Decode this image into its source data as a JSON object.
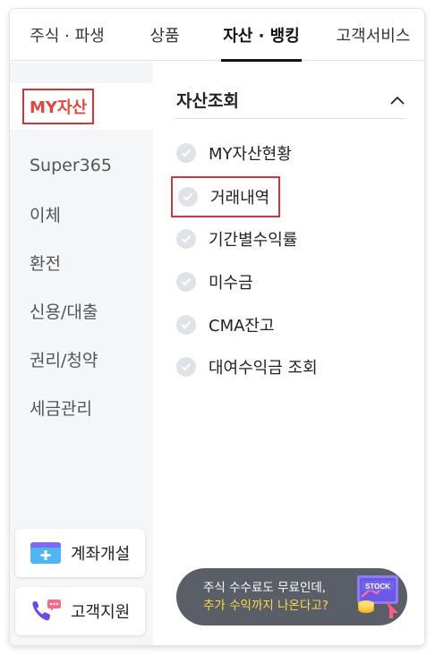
{
  "tabs": [
    {
      "label": "주식 · 파생"
    },
    {
      "label": "상품"
    },
    {
      "label": "자산 · 뱅킹"
    },
    {
      "label": "고객서비스"
    }
  ],
  "sidebar": {
    "items": [
      {
        "label": "MY자산"
      },
      {
        "label": "Super365"
      },
      {
        "label": "이체"
      },
      {
        "label": "환전"
      },
      {
        "label": "신용/대출"
      },
      {
        "label": "권리/청약"
      },
      {
        "label": "세금관리"
      }
    ],
    "buttons": {
      "open_account": "계좌개설",
      "support": "고객지원"
    }
  },
  "panel": {
    "title": "자산조회",
    "items": [
      {
        "label": "MY자산현황"
      },
      {
        "label": "거래내역"
      },
      {
        "label": "기간별수익률"
      },
      {
        "label": "미수금"
      },
      {
        "label": "CMA잔고"
      },
      {
        "label": "대여수익금 조회"
      }
    ]
  },
  "toast": {
    "line1": "주식 수수료도 무료인데,",
    "line2": "추가 수익까지 나온다고?",
    "badge": "STOCK"
  },
  "colors": {
    "highlight_red": "#d6323a",
    "toast_bg": "#5a5e66",
    "toast_accent": "#ffd84a"
  }
}
